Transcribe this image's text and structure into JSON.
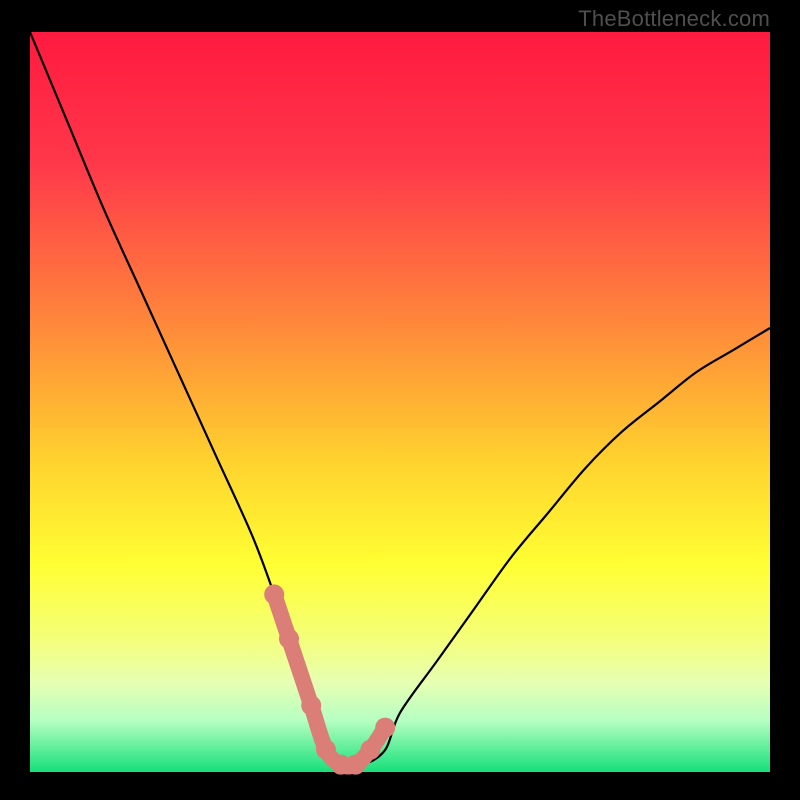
{
  "watermark": "TheBottleneck.com",
  "chart_data": {
    "type": "line",
    "title": "",
    "xlabel": "",
    "ylabel": "",
    "xlim": [
      0,
      100
    ],
    "ylim": [
      0,
      100
    ],
    "series": [
      {
        "name": "bottleneck-curve",
        "type": "line",
        "color": "#000000",
        "x": [
          0,
          5,
          10,
          15,
          20,
          25,
          30,
          33,
          35,
          38,
          40,
          42,
          45,
          48,
          50,
          55,
          60,
          65,
          70,
          75,
          80,
          85,
          90,
          95,
          100
        ],
        "y": [
          100,
          88,
          76,
          65,
          54,
          43,
          32,
          24,
          18,
          9,
          3,
          1,
          1,
          3,
          8,
          15,
          22,
          29,
          35,
          41,
          46,
          50,
          54,
          57,
          60
        ]
      },
      {
        "name": "highlight-markers",
        "type": "scatter",
        "color": "#db7e78",
        "x": [
          33,
          35,
          38,
          40,
          42,
          44,
          46,
          48
        ],
        "y": [
          24,
          18,
          9,
          3,
          1,
          1,
          3,
          6
        ]
      }
    ],
    "gradient_stops": [
      {
        "pct": 0,
        "color": "#ff1a3f"
      },
      {
        "pct": 18,
        "color": "#ff384a"
      },
      {
        "pct": 40,
        "color": "#ff8a3a"
      },
      {
        "pct": 58,
        "color": "#ffd22e"
      },
      {
        "pct": 72,
        "color": "#ffff33"
      },
      {
        "pct": 82,
        "color": "#f4ff7a"
      },
      {
        "pct": 88,
        "color": "#e6ffb3"
      },
      {
        "pct": 93,
        "color": "#b6ffc2"
      },
      {
        "pct": 100,
        "color": "#16e07a"
      }
    ],
    "highlight_color": "#db7e78",
    "curve_color": "#000000"
  }
}
